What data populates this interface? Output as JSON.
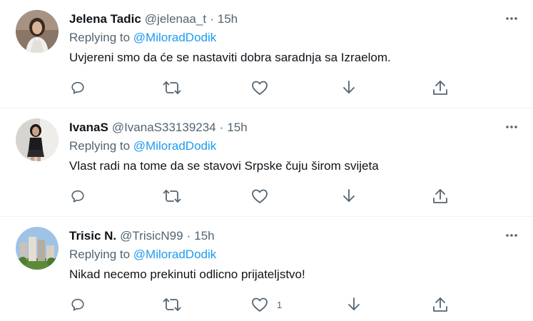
{
  "tweets": [
    {
      "display_name": "Jelena Tadic",
      "handle": "@jelenaa_t",
      "separator": "·",
      "time": "15h",
      "replying_prefix": "Replying to",
      "replying_to": "@MiloradDodik",
      "text": "Uvjereni smo da će se nastaviti dobra saradnja sa Izraelom.",
      "likes": ""
    },
    {
      "display_name": "IvanaS",
      "handle": "@IvanaS33139234",
      "separator": "·",
      "time": "15h",
      "replying_prefix": "Replying to",
      "replying_to": "@MiloradDodik",
      "text": "Vlast radi na tome da se stavovi Srpske čuju širom svijeta",
      "likes": ""
    },
    {
      "display_name": "Trisic N.",
      "handle": "@TrisicN99",
      "separator": "·",
      "time": "15h",
      "replying_prefix": "Replying to",
      "replying_to": "@MiloradDodik",
      "text": "Nikad necemo prekinuti odlicno prijateljstvo!",
      "likes": "1"
    }
  ],
  "icons": {
    "more": "more-horizontal-icon",
    "reply": "reply-bubble-icon",
    "retweet": "retweet-icon",
    "like": "heart-icon",
    "download": "download-arrow-icon",
    "share": "share-upload-icon"
  },
  "colors": {
    "text": "#0f1419",
    "secondary": "#536471",
    "mention": "#1d9bf0",
    "divider": "#eff3f4"
  }
}
